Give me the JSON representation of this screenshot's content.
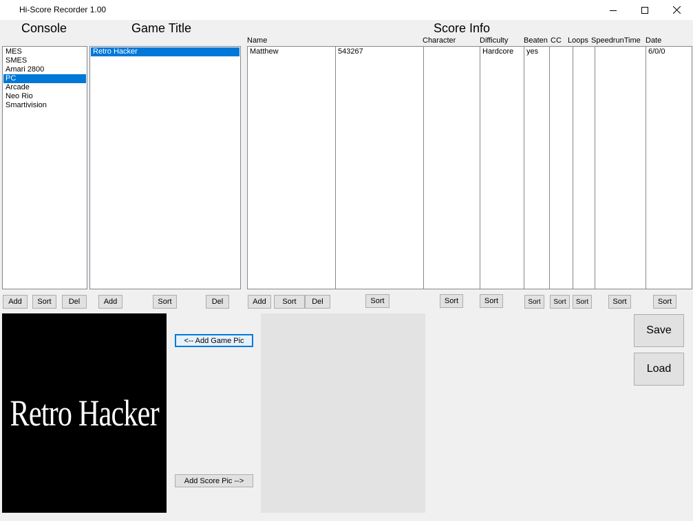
{
  "window": {
    "title": "Hi-Score Recorder 1.00",
    "controls": [
      "minimize-icon",
      "maximize-icon",
      "close-icon"
    ]
  },
  "headings": {
    "console": "Console",
    "game_title": "Game Title",
    "score_info": "Score Info"
  },
  "consoles": {
    "items": [
      "MES",
      "SMES",
      "Amari 2800",
      "PC",
      "Arcade",
      "Neo Rio",
      "Smartivision"
    ],
    "selected": "PC"
  },
  "games": {
    "items": [
      "Retro Hacker"
    ],
    "selected": "Retro Hacker"
  },
  "score_columns": [
    "Name",
    "",
    "Character",
    "Difficulty",
    "Beaten",
    "CC",
    "Loops",
    "SpeedrunTime",
    "Date"
  ],
  "score_row": [
    "Matthew",
    "543267",
    "",
    "Hardcore",
    "yes",
    "",
    "",
    "",
    "6/0/0"
  ],
  "buttons": {
    "add": "Add",
    "sort": "Sort",
    "del": "Del",
    "add_game_pic": "<-- Add Game Pic",
    "add_score_pic": "Add Score Pic -->",
    "save": "Save",
    "load": "Load"
  },
  "game_pic_text": "Retro Hacker",
  "colors": {
    "selection": "#0078d7",
    "background": "#f0f0f0",
    "game_pic_bg": "#000000",
    "score_pic_bg": "#e3e3e3"
  }
}
